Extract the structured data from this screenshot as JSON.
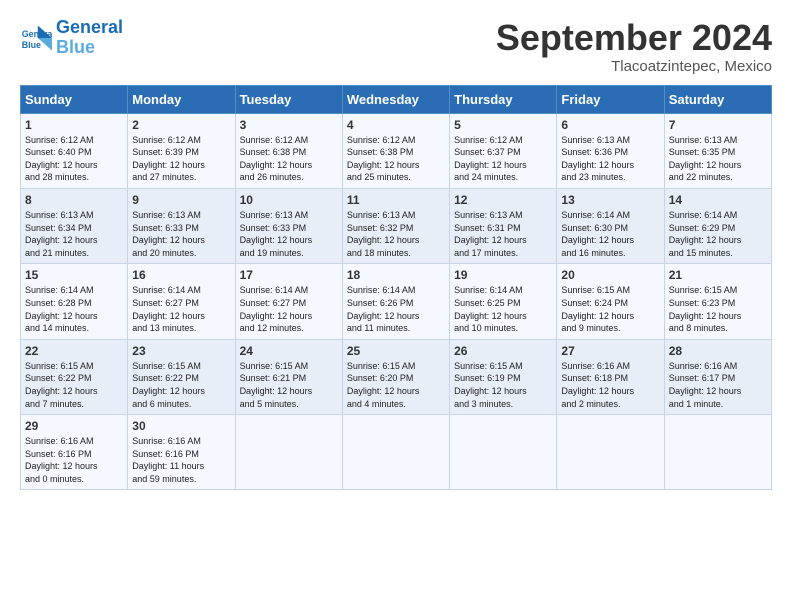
{
  "header": {
    "logo_line1": "General",
    "logo_line2": "Blue",
    "month": "September 2024",
    "location": "Tlacoatzintepec, Mexico"
  },
  "days_header": [
    "Sunday",
    "Monday",
    "Tuesday",
    "Wednesday",
    "Thursday",
    "Friday",
    "Saturday"
  ],
  "weeks": [
    [
      {
        "day": "1",
        "text": "Sunrise: 6:12 AM\nSunset: 6:40 PM\nDaylight: 12 hours\nand 28 minutes."
      },
      {
        "day": "2",
        "text": "Sunrise: 6:12 AM\nSunset: 6:39 PM\nDaylight: 12 hours\nand 27 minutes."
      },
      {
        "day": "3",
        "text": "Sunrise: 6:12 AM\nSunset: 6:38 PM\nDaylight: 12 hours\nand 26 minutes."
      },
      {
        "day": "4",
        "text": "Sunrise: 6:12 AM\nSunset: 6:38 PM\nDaylight: 12 hours\nand 25 minutes."
      },
      {
        "day": "5",
        "text": "Sunrise: 6:12 AM\nSunset: 6:37 PM\nDaylight: 12 hours\nand 24 minutes."
      },
      {
        "day": "6",
        "text": "Sunrise: 6:13 AM\nSunset: 6:36 PM\nDaylight: 12 hours\nand 23 minutes."
      },
      {
        "day": "7",
        "text": "Sunrise: 6:13 AM\nSunset: 6:35 PM\nDaylight: 12 hours\nand 22 minutes."
      }
    ],
    [
      {
        "day": "8",
        "text": "Sunrise: 6:13 AM\nSunset: 6:34 PM\nDaylight: 12 hours\nand 21 minutes."
      },
      {
        "day": "9",
        "text": "Sunrise: 6:13 AM\nSunset: 6:33 PM\nDaylight: 12 hours\nand 20 minutes."
      },
      {
        "day": "10",
        "text": "Sunrise: 6:13 AM\nSunset: 6:33 PM\nDaylight: 12 hours\nand 19 minutes."
      },
      {
        "day": "11",
        "text": "Sunrise: 6:13 AM\nSunset: 6:32 PM\nDaylight: 12 hours\nand 18 minutes."
      },
      {
        "day": "12",
        "text": "Sunrise: 6:13 AM\nSunset: 6:31 PM\nDaylight: 12 hours\nand 17 minutes."
      },
      {
        "day": "13",
        "text": "Sunrise: 6:14 AM\nSunset: 6:30 PM\nDaylight: 12 hours\nand 16 minutes."
      },
      {
        "day": "14",
        "text": "Sunrise: 6:14 AM\nSunset: 6:29 PM\nDaylight: 12 hours\nand 15 minutes."
      }
    ],
    [
      {
        "day": "15",
        "text": "Sunrise: 6:14 AM\nSunset: 6:28 PM\nDaylight: 12 hours\nand 14 minutes."
      },
      {
        "day": "16",
        "text": "Sunrise: 6:14 AM\nSunset: 6:27 PM\nDaylight: 12 hours\nand 13 minutes."
      },
      {
        "day": "17",
        "text": "Sunrise: 6:14 AM\nSunset: 6:27 PM\nDaylight: 12 hours\nand 12 minutes."
      },
      {
        "day": "18",
        "text": "Sunrise: 6:14 AM\nSunset: 6:26 PM\nDaylight: 12 hours\nand 11 minutes."
      },
      {
        "day": "19",
        "text": "Sunrise: 6:14 AM\nSunset: 6:25 PM\nDaylight: 12 hours\nand 10 minutes."
      },
      {
        "day": "20",
        "text": "Sunrise: 6:15 AM\nSunset: 6:24 PM\nDaylight: 12 hours\nand 9 minutes."
      },
      {
        "day": "21",
        "text": "Sunrise: 6:15 AM\nSunset: 6:23 PM\nDaylight: 12 hours\nand 8 minutes."
      }
    ],
    [
      {
        "day": "22",
        "text": "Sunrise: 6:15 AM\nSunset: 6:22 PM\nDaylight: 12 hours\nand 7 minutes."
      },
      {
        "day": "23",
        "text": "Sunrise: 6:15 AM\nSunset: 6:22 PM\nDaylight: 12 hours\nand 6 minutes."
      },
      {
        "day": "24",
        "text": "Sunrise: 6:15 AM\nSunset: 6:21 PM\nDaylight: 12 hours\nand 5 minutes."
      },
      {
        "day": "25",
        "text": "Sunrise: 6:15 AM\nSunset: 6:20 PM\nDaylight: 12 hours\nand 4 minutes."
      },
      {
        "day": "26",
        "text": "Sunrise: 6:15 AM\nSunset: 6:19 PM\nDaylight: 12 hours\nand 3 minutes."
      },
      {
        "day": "27",
        "text": "Sunrise: 6:16 AM\nSunset: 6:18 PM\nDaylight: 12 hours\nand 2 minutes."
      },
      {
        "day": "28",
        "text": "Sunrise: 6:16 AM\nSunset: 6:17 PM\nDaylight: 12 hours\nand 1 minute."
      }
    ],
    [
      {
        "day": "29",
        "text": "Sunrise: 6:16 AM\nSunset: 6:16 PM\nDaylight: 12 hours\nand 0 minutes."
      },
      {
        "day": "30",
        "text": "Sunrise: 6:16 AM\nSunset: 6:16 PM\nDaylight: 11 hours\nand 59 minutes."
      },
      {
        "day": "",
        "text": ""
      },
      {
        "day": "",
        "text": ""
      },
      {
        "day": "",
        "text": ""
      },
      {
        "day": "",
        "text": ""
      },
      {
        "day": "",
        "text": ""
      }
    ]
  ]
}
